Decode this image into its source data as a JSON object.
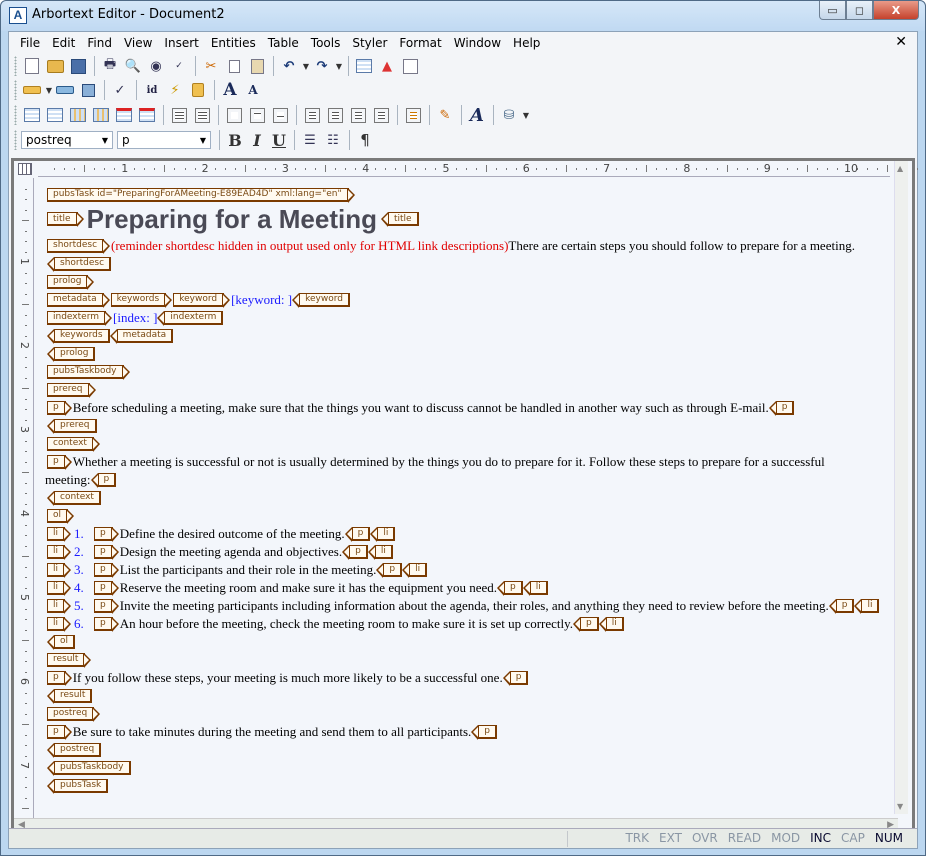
{
  "window": {
    "app_icon": "A",
    "title": "Arbortext Editor - Document2",
    "controls": {
      "minimize": "▭",
      "maximize": "◻",
      "close": "X"
    }
  },
  "menu": {
    "items": [
      "File",
      "Edit",
      "Find",
      "View",
      "Insert",
      "Entities",
      "Table",
      "Tools",
      "Styler",
      "Format",
      "Window",
      "Help"
    ],
    "close_doc": "✕"
  },
  "toolbar1": {
    "icons": [
      "new-document-icon",
      "open-icon",
      "save-icon",
      "print-icon",
      "print-preview-icon",
      "find-icon",
      "spellcheck-icon",
      "cut-icon",
      "copy-icon",
      "paste-icon",
      "undo-icon",
      "redo-icon",
      "table-icon",
      "insert-graphic-icon",
      "document-map-icon"
    ]
  },
  "toolbar2": {
    "icons": [
      "insert-markup-icon",
      "edit-tag-icon",
      "change-markup-icon",
      "check-completeness-icon",
      "insert-id-icon",
      "insert-reference-icon",
      "insert-entity-icon",
      "increase-font-icon",
      "decrease-font-icon"
    ],
    "glyphs": {
      "increase_font": "A",
      "decrease_font": "A"
    }
  },
  "toolbar3": {
    "icons": [
      "insert-row-above-icon",
      "insert-row-below-icon",
      "insert-column-left-icon",
      "insert-column-right-icon",
      "delete-row-icon",
      "delete-column-icon",
      "split-cell-icon",
      "merge-cell-icon",
      "align-top-icon",
      "align-middle-icon",
      "align-bottom-icon",
      "align-left-icon",
      "align-center-icon",
      "align-right-icon",
      "justify-icon",
      "cell-properties-icon",
      "edit-table-icon",
      "edit-style-icon",
      "fill-color-icon"
    ]
  },
  "toolbar4": {
    "element_combo": "postreq",
    "tag_combo": "p",
    "bold": "B",
    "italic": "I",
    "underline": "U",
    "pilcrow": "¶"
  },
  "ruler": {
    "h_labels": [
      "1",
      "2",
      "3",
      "4",
      "5",
      "6",
      "7",
      "8",
      "9",
      "10"
    ],
    "v_labels": [
      "1",
      "2",
      "3",
      "4",
      "5",
      "6",
      "7"
    ]
  },
  "document": {
    "pubsTask_open": "pubsTask id=\"PreparingForAMeeting-E89EAD4D\" xml:lang=\"en\"",
    "title_tag": "title",
    "title_text": "Preparing for a Meeting",
    "shortdesc_tag": "shortdesc",
    "shortdesc_reminder": "(reminder shortdesc hidden in output used only for HTML link descriptions)",
    "shortdesc_text": "There are certain steps you should follow to prepare for a meeting.",
    "prolog_tag": "prolog",
    "metadata_tag": "metadata",
    "keywords_tag": "keywords",
    "keyword_tag": "keyword",
    "keyword_placeholder": "[keyword: ]",
    "indexterm_tag": "indexterm",
    "index_placeholder": "[index: ]",
    "pubsTaskbody_tag": "pubsTaskbody",
    "prereq_tag": "prereq",
    "p_tag": "p",
    "prereq_text": "Before scheduling a meeting, make sure that the things you want to discuss cannot be handled in another way such as through E-mail.",
    "context_tag": "context",
    "context_text_1": "Whether a meeting is successful or not is usually determined by the things you do to prepare for it. Follow these steps to prepare for a successful",
    "context_text_2": "meeting:",
    "ol_tag": "ol",
    "li_tag": "li",
    "list_items": [
      {
        "num": "1.",
        "text": "Define the desired outcome of the meeting."
      },
      {
        "num": "2.",
        "text": "Design the meeting agenda and objectives."
      },
      {
        "num": "3.",
        "text": "List the participants and their role in the meeting."
      },
      {
        "num": "4.",
        "text": "Reserve the meeting room and make sure it has the equipment you need."
      },
      {
        "num": "5.",
        "text": "Invite the meeting participants including information about the agenda, their roles, and anything they need to review before the meeting."
      },
      {
        "num": "6.",
        "text": "An hour before the meeting, check the meeting room to make sure it is set up correctly."
      }
    ],
    "result_tag": "result",
    "result_text": "If you follow these steps, your meeting is much more likely to be a successful one.",
    "postreq_tag": "postreq",
    "postreq_text": "Be sure to take minutes during the meeting and send them to all participants.",
    "pubsTask_close": "pubsTask"
  },
  "statusbar": {
    "items": [
      {
        "label": "TRK",
        "active": false
      },
      {
        "label": "EXT",
        "active": false
      },
      {
        "label": "OVR",
        "active": false
      },
      {
        "label": "READ",
        "active": false
      },
      {
        "label": "MOD",
        "active": false
      },
      {
        "label": "INC",
        "active": true
      },
      {
        "label": "CAP",
        "active": false
      },
      {
        "label": "NUM",
        "active": true
      }
    ]
  }
}
